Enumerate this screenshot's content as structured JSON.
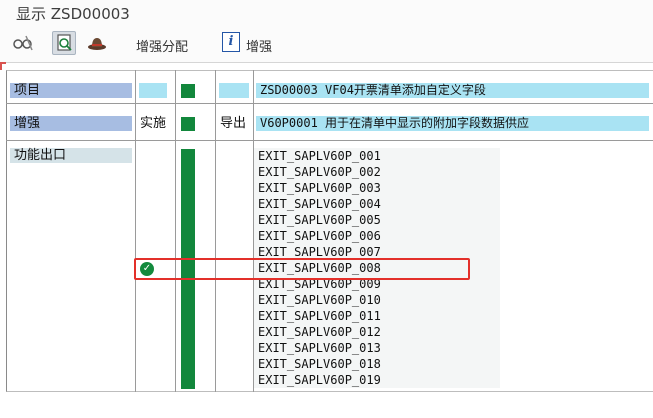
{
  "window": {
    "title": "显示 ZSD00003"
  },
  "toolbar": {
    "enhancement_assign_label": "增强分配",
    "enhancement_info_label": "增强",
    "info_glyph": "i"
  },
  "columns": {
    "implementation_header": "实施",
    "export_header": "导出"
  },
  "tree": {
    "project_label": "项目",
    "project_value": "ZSD00003 VF04开票清单添加自定义字段",
    "enhancement_label": "增强",
    "enhancement_value": "V60P0001 用于在清单中显示的附加字段数据供应",
    "function_exit_label": "功能出口",
    "exits": [
      "EXIT_SAPLV60P_001",
      "EXIT_SAPLV60P_002",
      "EXIT_SAPLV60P_003",
      "EXIT_SAPLV60P_004",
      "EXIT_SAPLV60P_005",
      "EXIT_SAPLV60P_006",
      "EXIT_SAPLV60P_007",
      "EXIT_SAPLV60P_008",
      "EXIT_SAPLV60P_009",
      "EXIT_SAPLV60P_010",
      "EXIT_SAPLV60P_011",
      "EXIT_SAPLV60P_012",
      "EXIT_SAPLV60P_013",
      "EXIT_SAPLV60P_018",
      "EXIT_SAPLV60P_019"
    ],
    "implemented_exit": "EXIT_SAPLV60P_008",
    "check_glyph": "✓"
  },
  "colors": {
    "header_blue": "#a7bde2",
    "cyan": "#a9e3f3",
    "status_green": "#12873c",
    "highlight_red": "#e3302a"
  }
}
